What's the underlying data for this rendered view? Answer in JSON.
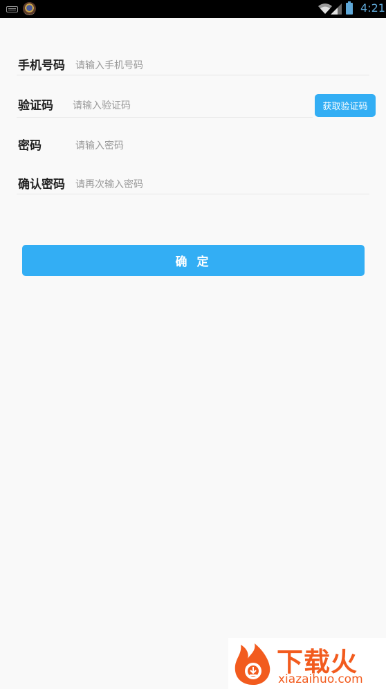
{
  "status_bar": {
    "time": "4:21",
    "icons": [
      "keyboard-icon",
      "app-avatar-icon",
      "wifi-icon",
      "signal-icon",
      "battery-icon"
    ]
  },
  "form": {
    "phone": {
      "label": "手机号码",
      "placeholder": "请输入手机号码",
      "value": ""
    },
    "code": {
      "label": "验证码",
      "placeholder": "请输入验证码",
      "value": "",
      "button_label": "获取验证码"
    },
    "password": {
      "label": "密码",
      "placeholder": "请输入密码",
      "value": ""
    },
    "confirm_password": {
      "label": "确认密码",
      "placeholder": "请再次输入密码",
      "value": ""
    }
  },
  "submit": {
    "label": "确 定"
  },
  "watermark": {
    "title": "下载火",
    "url": "xiazaihuo.com"
  },
  "colors": {
    "accent": "#33aef4",
    "background": "#f9f9f9",
    "watermark": "#f25b1e"
  }
}
